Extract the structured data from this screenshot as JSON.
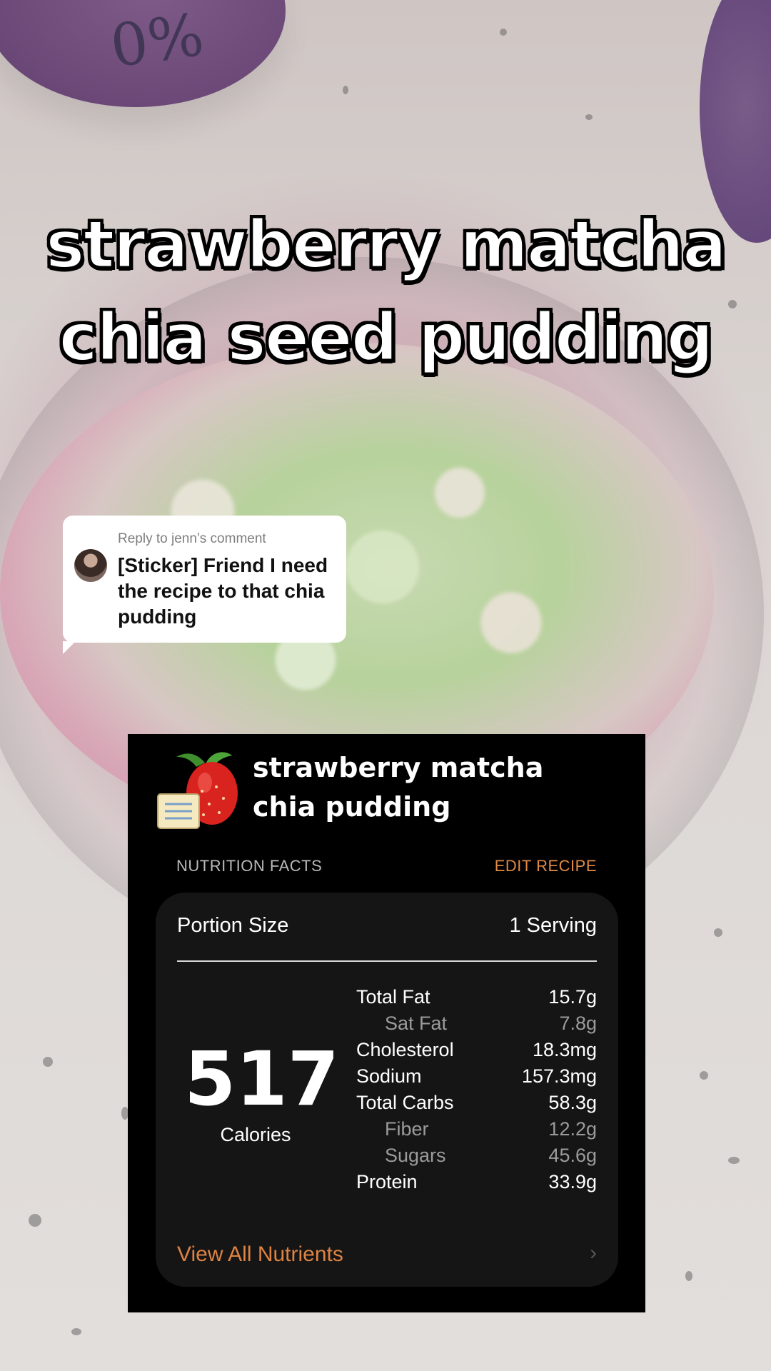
{
  "overlay": {
    "title_lines": [
      "strawberry matcha",
      "chia seed pudding"
    ],
    "cup_label": "0%"
  },
  "reply": {
    "header": "Reply to jenn’s comment",
    "text": "[Sticker] Friend I need the recipe to that chia pudding"
  },
  "card": {
    "recipe_title_lines": [
      "strawberry matcha",
      "chia pudding"
    ],
    "section_label": "NUTRITION FACTS",
    "edit_label": "EDIT RECIPE",
    "portion_label": "Portion Size",
    "portion_value": "1 Serving",
    "calories_value": "517",
    "calories_label": "Calories",
    "nutrients": [
      {
        "name": "Total Fat",
        "value": "15.7g",
        "sub": false
      },
      {
        "name": "Sat Fat",
        "value": "7.8g",
        "sub": true
      },
      {
        "name": "Cholesterol",
        "value": "18.3mg",
        "sub": false
      },
      {
        "name": "Sodium",
        "value": "157.3mg",
        "sub": false
      },
      {
        "name": "Total Carbs",
        "value": "58.3g",
        "sub": false
      },
      {
        "name": "Fiber",
        "value": "12.2g",
        "sub": true
      },
      {
        "name": "Sugars",
        "value": "45.6g",
        "sub": true
      },
      {
        "name": "Protein",
        "value": "33.9g",
        "sub": false
      }
    ],
    "view_all_label": "View All Nutrients",
    "accent_color": "#e08a45",
    "icon": "strawberry-recipe-icon"
  }
}
